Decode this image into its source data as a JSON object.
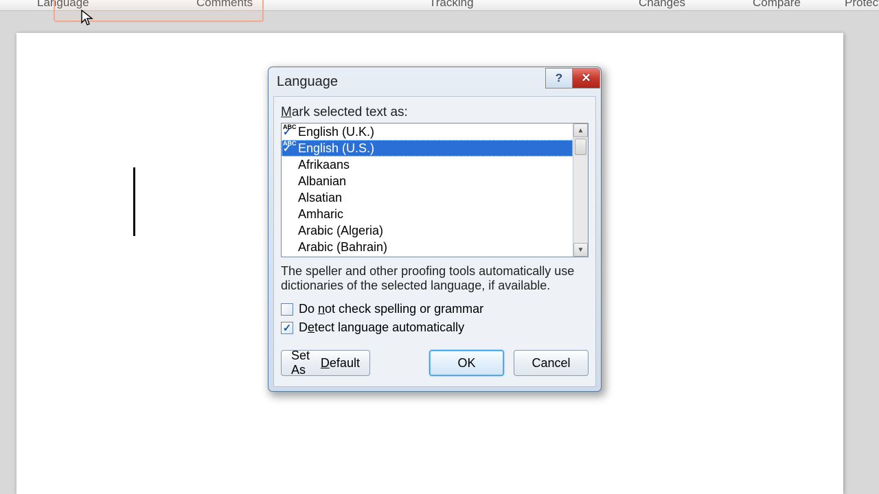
{
  "ribbon": {
    "groups": [
      "Language",
      "Comments",
      "Tracking",
      "Changes",
      "Compare",
      "Protect"
    ]
  },
  "dialog": {
    "title": "Language",
    "prompt_pre": "M",
    "prompt_post": "ark selected text as:",
    "languages": [
      {
        "label": "English (U.K.)",
        "has_spellcheck": true,
        "selected": false
      },
      {
        "label": "English (U.S.)",
        "has_spellcheck": true,
        "selected": true
      },
      {
        "label": "Afrikaans",
        "has_spellcheck": false,
        "selected": false
      },
      {
        "label": "Albanian",
        "has_spellcheck": false,
        "selected": false
      },
      {
        "label": "Alsatian",
        "has_spellcheck": false,
        "selected": false
      },
      {
        "label": "Amharic",
        "has_spellcheck": false,
        "selected": false
      },
      {
        "label": "Arabic (Algeria)",
        "has_spellcheck": false,
        "selected": false
      },
      {
        "label": "Arabic (Bahrain)",
        "has_spellcheck": false,
        "selected": false
      }
    ],
    "info": "The speller and other proofing tools automatically use dictionaries of the selected language, if available.",
    "checkbox1": {
      "pre": "Do ",
      "accel": "n",
      "post": "ot check spelling or grammar",
      "checked": false
    },
    "checkbox2": {
      "pre": "D",
      "accel": "e",
      "post": "tect language automatically",
      "checked": true
    },
    "buttons": {
      "set_default_pre": "Set As ",
      "set_default_accel": "D",
      "set_default_post": "efault",
      "ok": "OK",
      "cancel": "Cancel"
    }
  }
}
